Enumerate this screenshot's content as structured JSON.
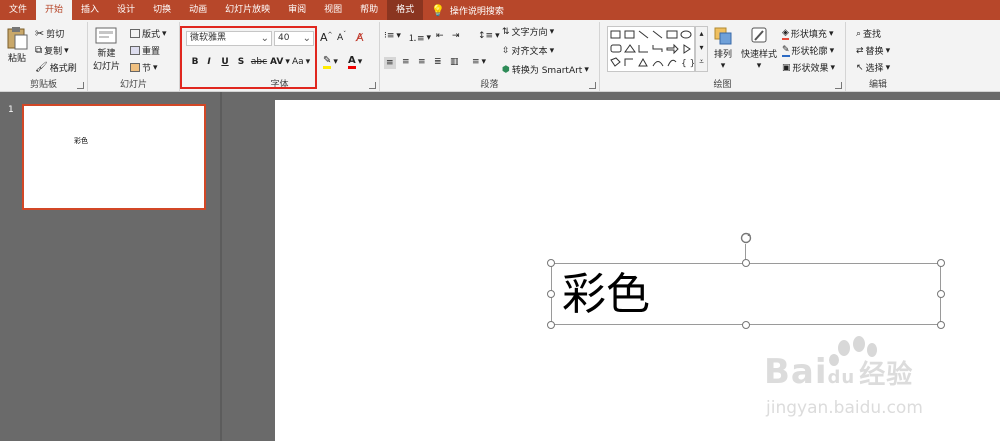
{
  "tabs": [
    {
      "label": "文件",
      "active": false
    },
    {
      "label": "开始",
      "active": true
    },
    {
      "label": "插入",
      "active": false
    },
    {
      "label": "设计",
      "active": false
    },
    {
      "label": "切换",
      "active": false
    },
    {
      "label": "动画",
      "active": false
    },
    {
      "label": "幻灯片放映",
      "active": false
    },
    {
      "label": "审阅",
      "active": false
    },
    {
      "label": "视图",
      "active": false
    },
    {
      "label": "帮助",
      "active": false
    },
    {
      "label": "格式",
      "active": false
    }
  ],
  "tell_me": "操作说明搜索",
  "clipboard": {
    "paste": "粘贴",
    "cut": "剪切",
    "copy": "复制",
    "format_painter": "格式刷",
    "label": "剪贴板"
  },
  "slides_group": {
    "new_slide_1": "新建",
    "new_slide_2": "幻灯片",
    "layout": "版式",
    "reset": "重置",
    "section": "节",
    "label": "幻灯片"
  },
  "font": {
    "name": "微软雅黑",
    "size": "40",
    "bold": "B",
    "italic": "I",
    "underline": "U",
    "shadow": "S",
    "strike": "abc",
    "spacing": "AV",
    "case": "Aa",
    "label": "字体"
  },
  "paragraph": {
    "text_direction": "文字方向",
    "align_text": "对齐文本",
    "smartart": "转换为 SmartArt",
    "label": "段落"
  },
  "drawing": {
    "arrange": "排列",
    "quick_styles": "快速样式",
    "shape_fill": "形状填充",
    "shape_outline": "形状轮廓",
    "shape_effects": "形状效果",
    "label": "绘图"
  },
  "editing": {
    "find": "查找",
    "replace": "替换",
    "select": "选择",
    "label": "编辑"
  },
  "thumbnail": {
    "number": "1",
    "text": "彩色"
  },
  "slide": {
    "text": "彩色"
  },
  "watermark": {
    "brand_text": "Bai",
    "brand_suffix": "du",
    "brand_cn": "经验",
    "url": "jingyan.baidu.com"
  },
  "colors": {
    "accent": "#b7472a",
    "selection": "#d24726",
    "highlight_box": "#e0261e"
  }
}
